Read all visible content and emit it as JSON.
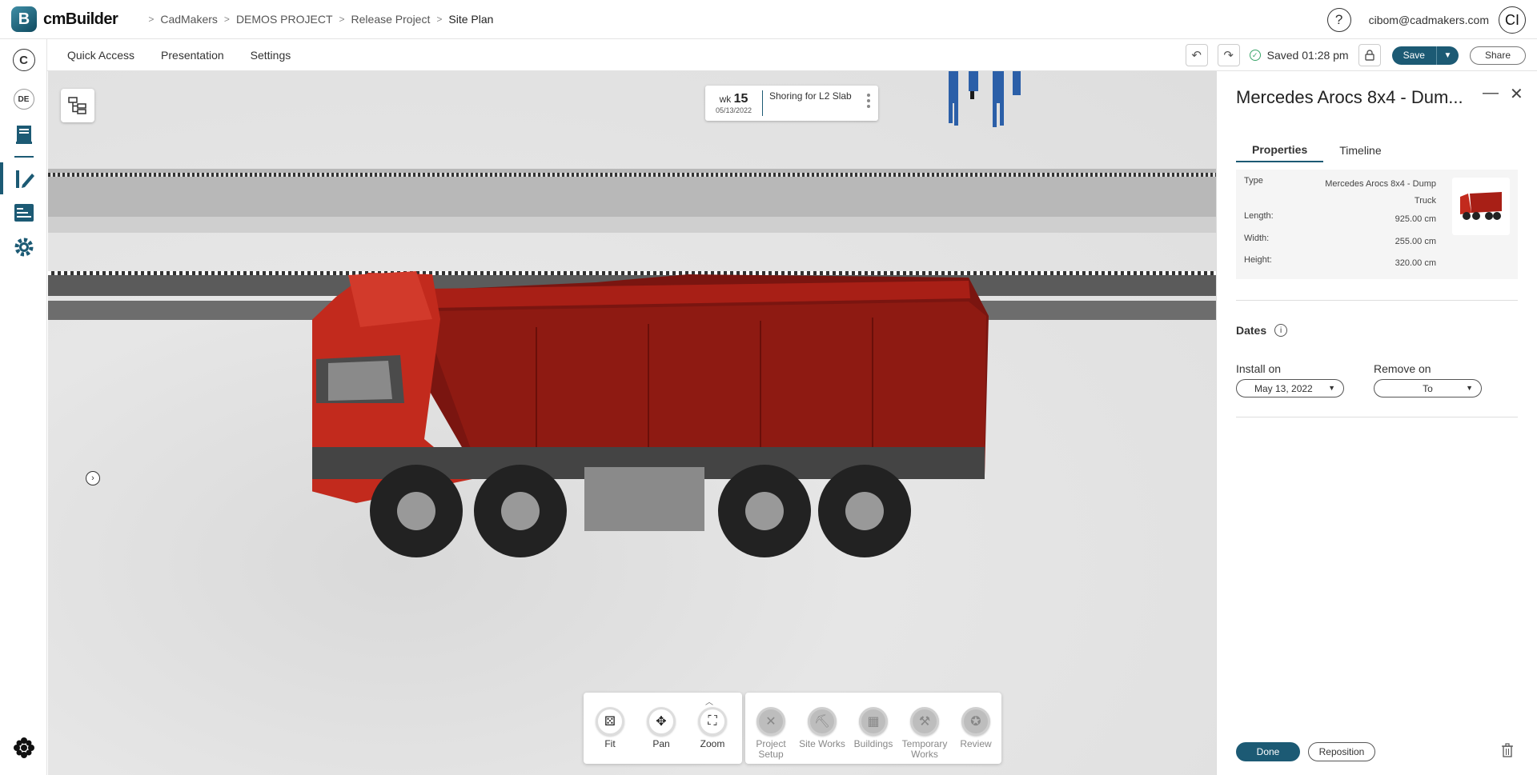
{
  "app": {
    "name": "cmBuilder",
    "logo_letter": "B"
  },
  "breadcrumb": [
    "CadMakers",
    "DEMOS PROJECT",
    "Release Project",
    "Site Plan"
  ],
  "user": {
    "email": "cibom@cadmakers.com",
    "initials": "CI"
  },
  "help_label": "?",
  "rail": {
    "c_label": "C",
    "de_label": "DE"
  },
  "menu": [
    "Quick Access",
    "Presentation",
    "Settings"
  ],
  "status": {
    "saved": "Saved 01:28 pm"
  },
  "buttons": {
    "save": "Save",
    "share": "Share",
    "done": "Done",
    "reposition": "Reposition"
  },
  "task": {
    "wk_prefix": "wk",
    "week": "15",
    "date": "05/13/2022",
    "title": "Shoring for L2 Slab"
  },
  "tools": {
    "nav": [
      {
        "label": "Fit",
        "icon": "fit-icon"
      },
      {
        "label": "Pan",
        "icon": "pan-icon"
      },
      {
        "label": "Zoom",
        "icon": "zoom-icon"
      }
    ],
    "build": [
      {
        "label": "Project Setup",
        "icon": "project-setup-icon"
      },
      {
        "label": "Site Works",
        "icon": "site-works-icon"
      },
      {
        "label": "Buildings",
        "icon": "buildings-icon"
      },
      {
        "label": "Temporary Works",
        "icon": "temporary-works-icon"
      },
      {
        "label": "Review",
        "icon": "review-icon"
      }
    ]
  },
  "panel": {
    "title": "Mercedes Arocs 8x4 - Dum...",
    "tabs": [
      "Properties",
      "Timeline"
    ],
    "props": {
      "type_label": "Type",
      "type_value": "Mercedes Arocs 8x4 - Dump Truck",
      "length_label": "Length:",
      "length_value": "925.00 cm",
      "width_label": "Width:",
      "width_value": "255.00 cm",
      "height_label": "Height:",
      "height_value": "320.00 cm"
    },
    "dates": {
      "title": "Dates",
      "install_label": "Install on",
      "install_value": "May 13, 2022",
      "remove_label": "Remove on",
      "remove_value": "To"
    }
  },
  "colors": {
    "accent": "#1c5a74",
    "truck_red": "#b8241a",
    "saved_green": "#3aa56a"
  }
}
